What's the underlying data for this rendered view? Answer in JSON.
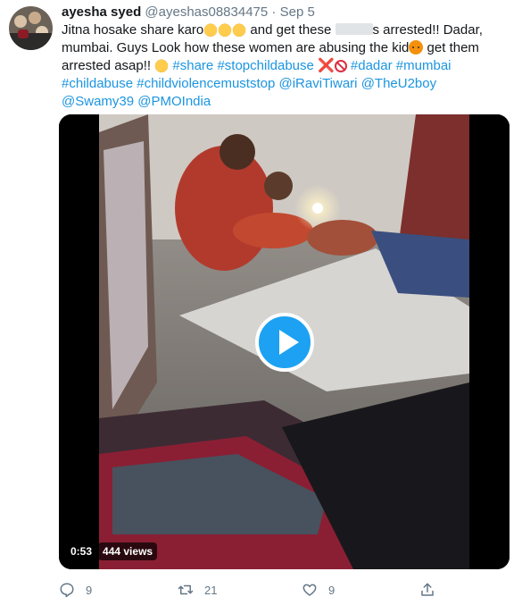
{
  "tweet": {
    "name": "ayesha syed",
    "handle": "@ayeshas08834475",
    "separator": "·",
    "date": "Sep 5",
    "text": {
      "t1": "Jitna hosake share karo",
      "t2": " and get these ",
      "t3": "s arrested!! Dadar, mumbai. Guys Look how these women are abusing the kid",
      "t4": " get them arrested asap!! ",
      "hashtags": {
        "share": "#share",
        "stopchildabuse": "#stopchildabuse",
        "dadar": "#dadar",
        "mumbai": "#mumbai",
        "childabuse": "#childabuse",
        "childviolencemuststop": "#childviolencemuststop"
      },
      "mentions": {
        "iravitiwari": "@iRaviTiwari",
        "theu2boy": "@TheU2boy",
        "swamy39": "@Swamy39",
        "pmoindia": "@PMOIndia"
      }
    },
    "emoji": {
      "pray": "folded-hands-emoji",
      "angry": "angry-face-emoji",
      "cross": "❌",
      "no_entry": "no-entry-emoji"
    }
  },
  "video": {
    "duration": "0:53",
    "views": "444 views"
  },
  "actions": {
    "reply_count": "9",
    "retweet_count": "21",
    "like_count": "9"
  },
  "colors": {
    "link": "#1b95e0",
    "play_button": "#1da1f2",
    "muted": "#657786"
  }
}
